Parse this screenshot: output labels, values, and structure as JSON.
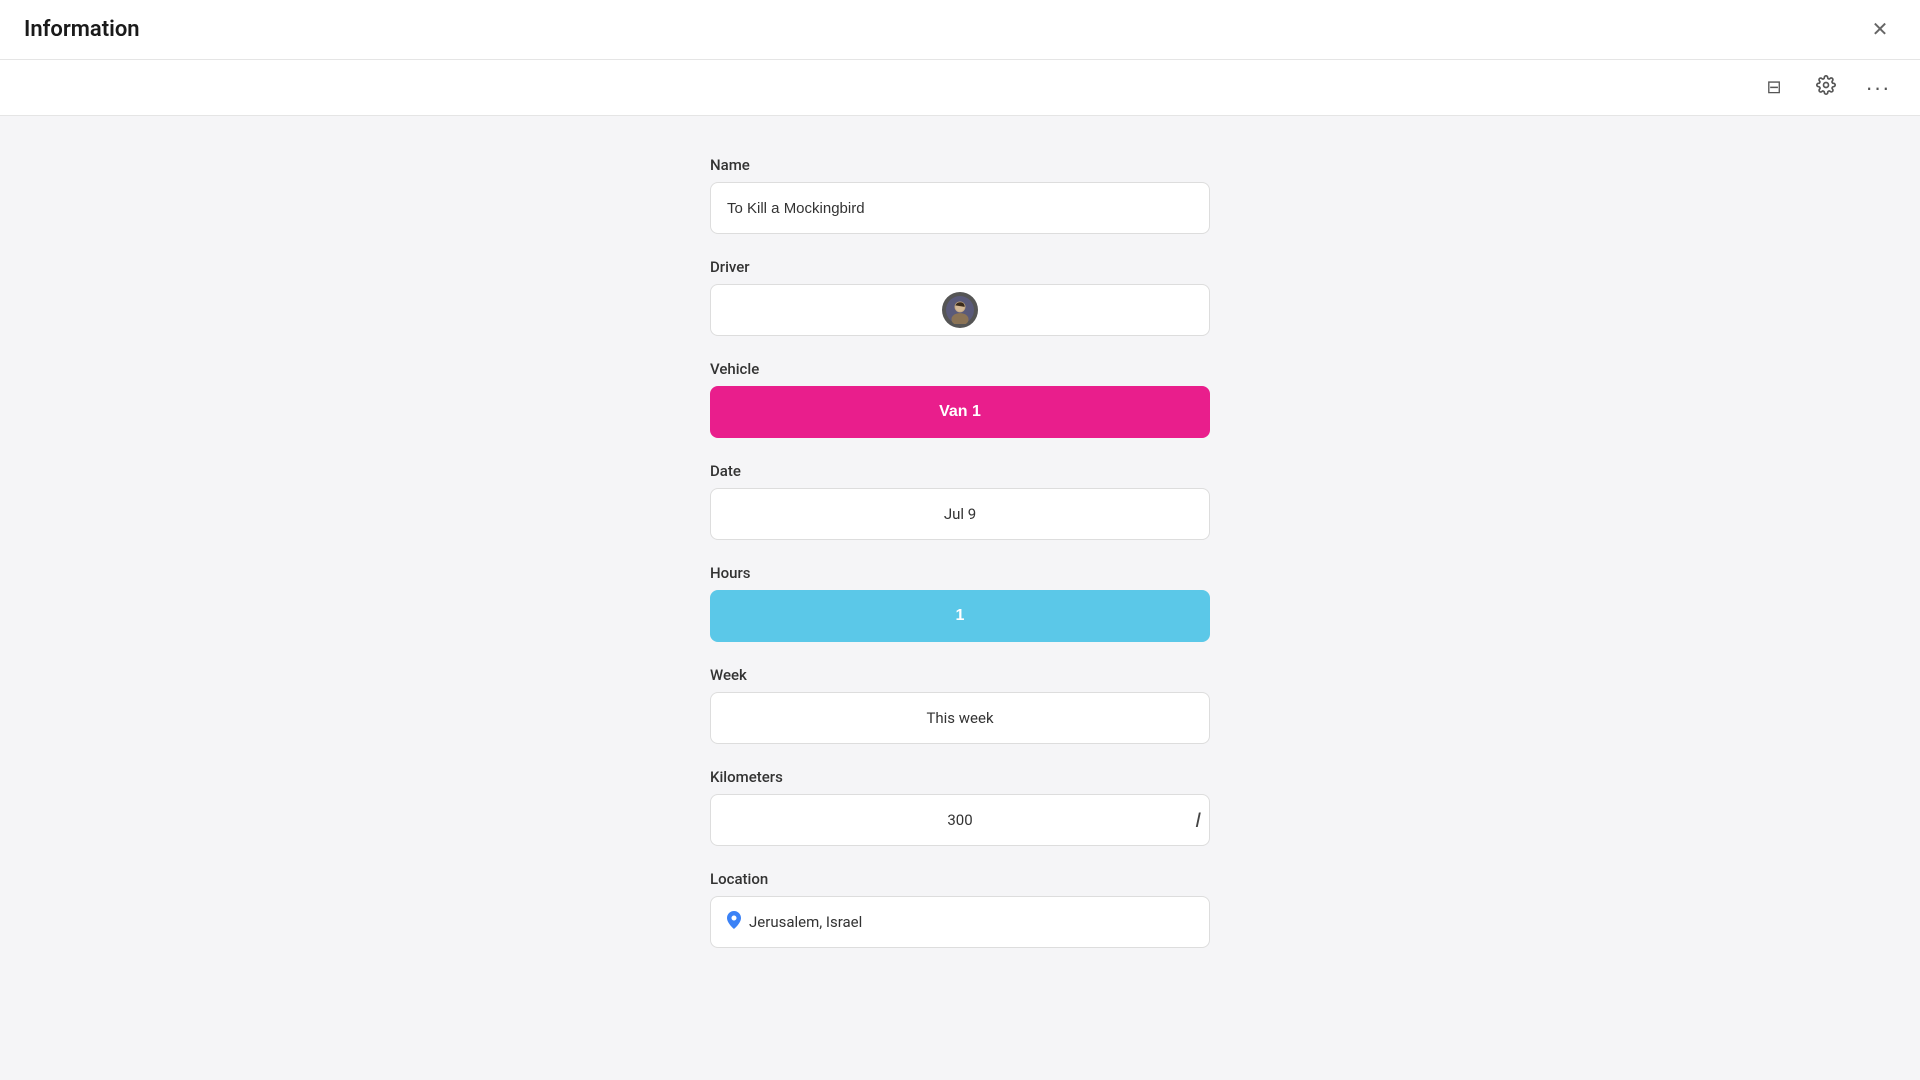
{
  "window": {
    "title": "Information",
    "close_label": "✕"
  },
  "toolbar": {
    "layout_icon": "⊟",
    "settings_icon": "⚙",
    "more_icon": "···"
  },
  "form": {
    "name_label": "Name",
    "name_value": "To Kill a Mockingbird",
    "driver_label": "Driver",
    "driver_avatar": "👤",
    "vehicle_label": "Vehicle",
    "vehicle_value": "Van 1",
    "date_label": "Date",
    "date_value": "Jul 9",
    "hours_label": "Hours",
    "hours_value": "1",
    "week_label": "Week",
    "week_value": "This week",
    "kilometers_label": "Kilometers",
    "kilometers_value": "300",
    "location_label": "Location",
    "location_value": "Jerusalem, Israel",
    "location_pin": "📍"
  }
}
